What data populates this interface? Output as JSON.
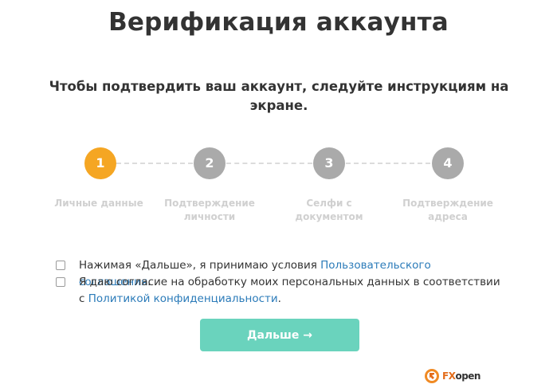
{
  "page": {
    "title": "Верификация аккаунта",
    "subtitle": "Чтобы подтвердить ваш аккаунт, следуйте инструкциям на экране."
  },
  "colors": {
    "active_step": "#f5a623",
    "inactive_step": "#aaaaaa",
    "step_label": "#d0d0d0",
    "link": "#2b7bb9",
    "button": "#6ad3bd"
  },
  "steps": [
    {
      "number": "1",
      "label": "Личные данные",
      "active": true
    },
    {
      "number": "2",
      "label": "Подтверждение личности",
      "active": false
    },
    {
      "number": "3",
      "label": "Селфи с документом",
      "active": false
    },
    {
      "number": "4",
      "label": "Подтверждение адреса",
      "active": false
    }
  ],
  "consent": {
    "terms": {
      "text": "Нажимая «Дальше», я принимаю условия ",
      "link": "Пользовательского соглашения",
      "end": "."
    },
    "privacy": {
      "text": "Я даю согласие на обработку моих персональных данных в соответствии с ",
      "link": "Политикой конфиденциальности",
      "end": "."
    }
  },
  "next_button": {
    "label": "Дальше →"
  },
  "logo": {
    "fx": "FX",
    "open": "open",
    "icon": "fxopen-lion-icon"
  }
}
